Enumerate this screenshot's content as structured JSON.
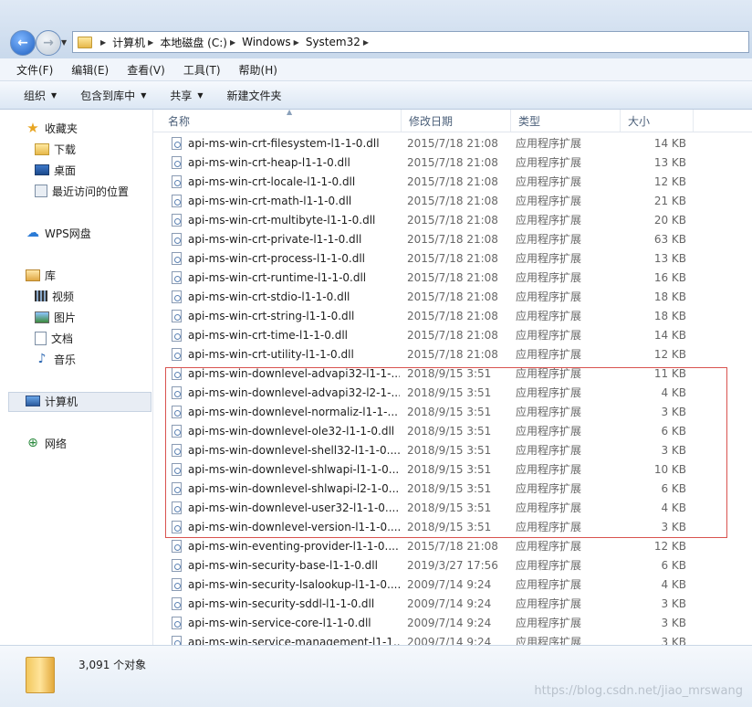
{
  "address": {
    "crumbs": [
      "计算机",
      "本地磁盘 (C:)",
      "Windows",
      "System32"
    ]
  },
  "menu": [
    "文件(F)",
    "编辑(E)",
    "查看(V)",
    "工具(T)",
    "帮助(H)"
  ],
  "toolbar": [
    {
      "label": "组织",
      "dropdown": true
    },
    {
      "label": "包含到库中",
      "dropdown": true
    },
    {
      "label": "共享",
      "dropdown": true
    },
    {
      "label": "新建文件夹",
      "dropdown": false
    }
  ],
  "nav": {
    "favorites": "收藏夹",
    "downloads": "下载",
    "desktop": "桌面",
    "recent": "最近访问的位置",
    "wps": "WPS网盘",
    "libraries": "库",
    "videos": "视频",
    "pictures": "图片",
    "documents": "文档",
    "music": "音乐",
    "computer": "计算机",
    "network": "网络"
  },
  "columns": {
    "name": "名称",
    "date": "修改日期",
    "type": "类型",
    "size": "大小"
  },
  "files": [
    [
      "api-ms-win-crt-filesystem-l1-1-0.dll",
      "2015/7/18 21:08",
      "应用程序扩展",
      "14 KB"
    ],
    [
      "api-ms-win-crt-heap-l1-1-0.dll",
      "2015/7/18 21:08",
      "应用程序扩展",
      "13 KB"
    ],
    [
      "api-ms-win-crt-locale-l1-1-0.dll",
      "2015/7/18 21:08",
      "应用程序扩展",
      "12 KB"
    ],
    [
      "api-ms-win-crt-math-l1-1-0.dll",
      "2015/7/18 21:08",
      "应用程序扩展",
      "21 KB"
    ],
    [
      "api-ms-win-crt-multibyte-l1-1-0.dll",
      "2015/7/18 21:08",
      "应用程序扩展",
      "20 KB"
    ],
    [
      "api-ms-win-crt-private-l1-1-0.dll",
      "2015/7/18 21:08",
      "应用程序扩展",
      "63 KB"
    ],
    [
      "api-ms-win-crt-process-l1-1-0.dll",
      "2015/7/18 21:08",
      "应用程序扩展",
      "13 KB"
    ],
    [
      "api-ms-win-crt-runtime-l1-1-0.dll",
      "2015/7/18 21:08",
      "应用程序扩展",
      "16 KB"
    ],
    [
      "api-ms-win-crt-stdio-l1-1-0.dll",
      "2015/7/18 21:08",
      "应用程序扩展",
      "18 KB"
    ],
    [
      "api-ms-win-crt-string-l1-1-0.dll",
      "2015/7/18 21:08",
      "应用程序扩展",
      "18 KB"
    ],
    [
      "api-ms-win-crt-time-l1-1-0.dll",
      "2015/7/18 21:08",
      "应用程序扩展",
      "14 KB"
    ],
    [
      "api-ms-win-crt-utility-l1-1-0.dll",
      "2015/7/18 21:08",
      "应用程序扩展",
      "12 KB"
    ],
    [
      "api-ms-win-downlevel-advapi32-l1-1-...",
      "2018/9/15 3:51",
      "应用程序扩展",
      "11 KB"
    ],
    [
      "api-ms-win-downlevel-advapi32-l2-1-...",
      "2018/9/15 3:51",
      "应用程序扩展",
      "4 KB"
    ],
    [
      "api-ms-win-downlevel-normaliz-l1-1-...",
      "2018/9/15 3:51",
      "应用程序扩展",
      "3 KB"
    ],
    [
      "api-ms-win-downlevel-ole32-l1-1-0.dll",
      "2018/9/15 3:51",
      "应用程序扩展",
      "6 KB"
    ],
    [
      "api-ms-win-downlevel-shell32-l1-1-0....",
      "2018/9/15 3:51",
      "应用程序扩展",
      "3 KB"
    ],
    [
      "api-ms-win-downlevel-shlwapi-l1-1-0....",
      "2018/9/15 3:51",
      "应用程序扩展",
      "10 KB"
    ],
    [
      "api-ms-win-downlevel-shlwapi-l2-1-0....",
      "2018/9/15 3:51",
      "应用程序扩展",
      "6 KB"
    ],
    [
      "api-ms-win-downlevel-user32-l1-1-0....",
      "2018/9/15 3:51",
      "应用程序扩展",
      "4 KB"
    ],
    [
      "api-ms-win-downlevel-version-l1-1-0....",
      "2018/9/15 3:51",
      "应用程序扩展",
      "3 KB"
    ],
    [
      "api-ms-win-eventing-provider-l1-1-0....",
      "2015/7/18 21:08",
      "应用程序扩展",
      "12 KB"
    ],
    [
      "api-ms-win-security-base-l1-1-0.dll",
      "2019/3/27 17:56",
      "应用程序扩展",
      "6 KB"
    ],
    [
      "api-ms-win-security-lsalookup-l1-1-0....",
      "2009/7/14 9:24",
      "应用程序扩展",
      "4 KB"
    ],
    [
      "api-ms-win-security-sddl-l1-1-0.dll",
      "2009/7/14 9:24",
      "应用程序扩展",
      "3 KB"
    ],
    [
      "api-ms-win-service-core-l1-1-0.dll",
      "2009/7/14 9:24",
      "应用程序扩展",
      "3 KB"
    ],
    [
      "api-ms-win-service-management-l1-1...",
      "2009/7/14 9:24",
      "应用程序扩展",
      "3 KB"
    ]
  ],
  "status": {
    "count": "3,091 个对象"
  },
  "watermark": "https://blog.csdn.net/jiao_mrswang"
}
